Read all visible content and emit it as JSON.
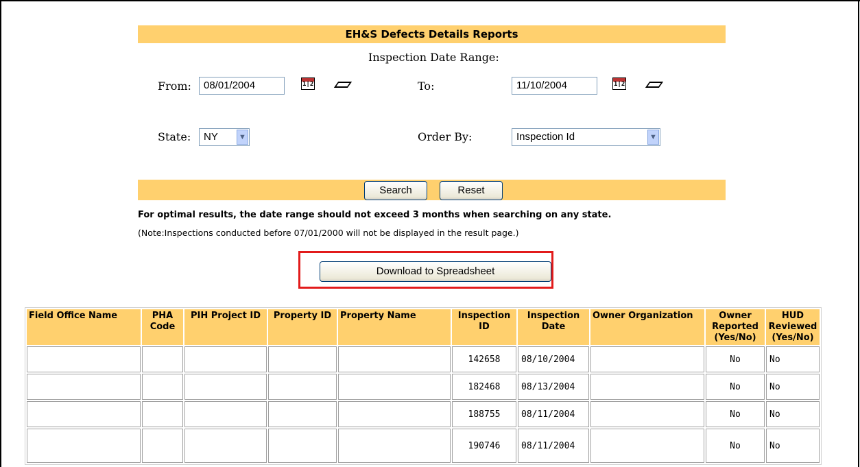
{
  "report": {
    "title": "EH&S Defects Details Reports",
    "date_range_label": "Inspection Date Range:",
    "from_label": "From:",
    "from_value": "08/01/2004",
    "to_label": "To:",
    "to_value": "11/10/2004",
    "state_label": "State:",
    "state_value": "NY",
    "order_by_label": "Order By:",
    "order_by_value": "Inspection Id",
    "search_label": "Search",
    "reset_label": "Reset",
    "optimal_note": "For optimal results, the date range should not exceed 3 months when searching on any state.",
    "note": "(Note:Inspections conducted before 07/01/2000 will not be displayed in the result page.)",
    "download_label": "Download to Spreadsheet",
    "calendar_icon_glyph": "1|2"
  },
  "colors": {
    "band": "#ffd06e",
    "highlight": "#e21b1b"
  },
  "table": {
    "headers": [
      "Field Office Name",
      "PHA Code",
      "PIH Project ID",
      "Property ID",
      "Property Name",
      "Inspection ID",
      "Inspection Date",
      "Owner Organization",
      "Owner Reported (Yes/No)",
      "HUD Reviewed (Yes/No)"
    ],
    "rows": [
      [
        "",
        "",
        "",
        "",
        "",
        "142658",
        "08/10/2004",
        "",
        "No",
        "No"
      ],
      [
        "",
        "",
        "",
        "",
        "",
        "182468",
        "08/13/2004",
        "",
        "No",
        "No"
      ],
      [
        "",
        "",
        "",
        "",
        "",
        "188755",
        "08/11/2004",
        "",
        "No",
        "No"
      ],
      [
        "",
        "",
        "",
        "",
        "",
        "190746",
        "08/11/2004",
        "",
        "No",
        "No"
      ]
    ]
  }
}
